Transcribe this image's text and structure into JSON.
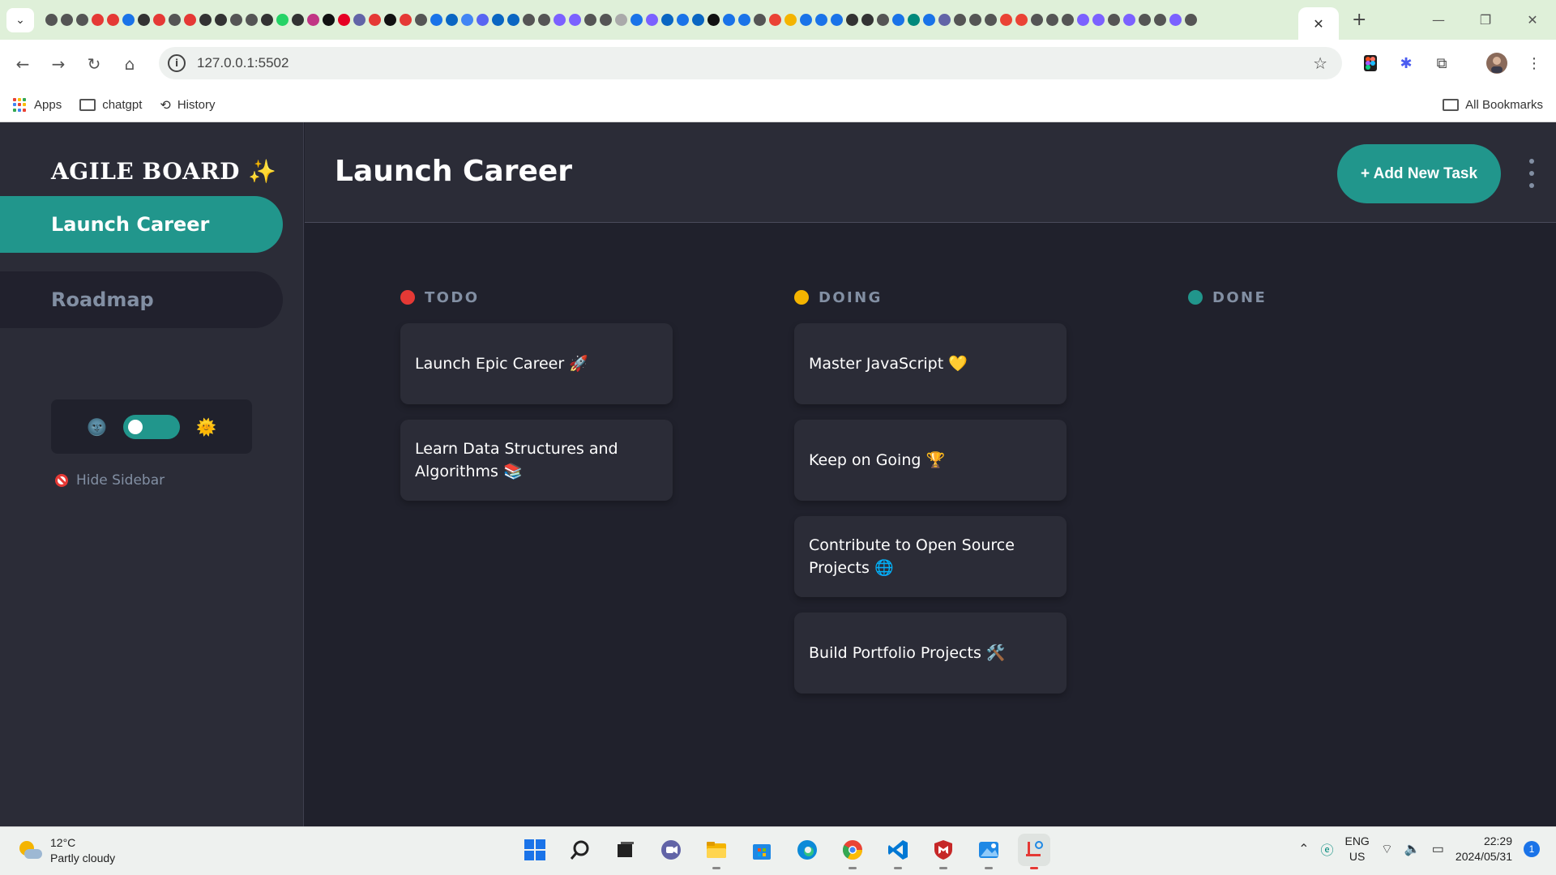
{
  "browser": {
    "address": "127.0.0.1:5502",
    "bookmarks": [
      {
        "label": "Apps",
        "icon": "apps-grid-icon"
      },
      {
        "label": "chatgpt",
        "icon": "folder-icon"
      },
      {
        "label": "History",
        "icon": "history-icon"
      }
    ],
    "all_bookmarks": "All Bookmarks"
  },
  "sidebar": {
    "brand": "AGILE BOARD ✨",
    "boards": [
      {
        "label": "Launch Career",
        "active": true
      },
      {
        "label": "Roadmap",
        "active": false
      }
    ],
    "theme_dark_emoji": "🌚",
    "theme_light_emoji": "🌞",
    "hide_label": "Hide Sidebar"
  },
  "header": {
    "title": "Launch Career",
    "add_task": "+ Add New Task"
  },
  "columns": [
    {
      "name": "TODO",
      "color": "#e53935",
      "tasks": [
        "Launch Epic Career 🚀",
        "Learn Data Structures and Algorithms 📚"
      ]
    },
    {
      "name": "DOING",
      "color": "#f4b400",
      "tasks": [
        "Master JavaScript 💛",
        "Keep on Going 🏆",
        "Contribute to Open Source Projects 🌐",
        "Build Portfolio Projects 🛠️"
      ]
    },
    {
      "name": "DONE",
      "color": "#21968c",
      "tasks": []
    }
  ],
  "taskbar": {
    "temperature": "12°C",
    "condition": "Partly cloudy",
    "lang_top": "ENG",
    "lang_bottom": "US",
    "time": "22:29",
    "date": "2024/05/31",
    "notifications": "1"
  },
  "colors": {
    "accent": "#21968c",
    "surface": "#2b2c37",
    "background": "#20212c",
    "muted_text": "#828fa3"
  }
}
